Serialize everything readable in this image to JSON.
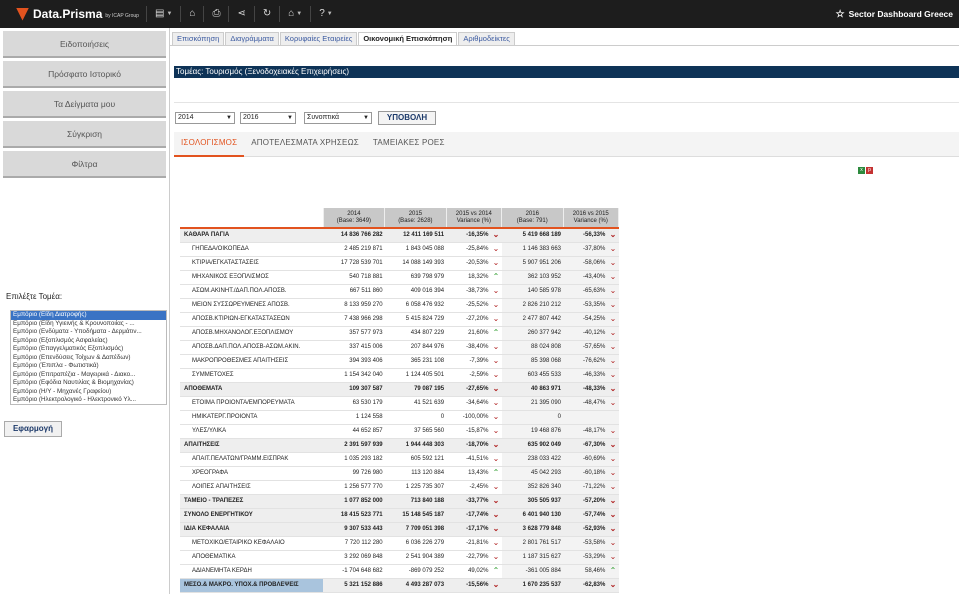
{
  "app": {
    "name": "Data.Prisma",
    "by": "by ICAP Group",
    "dashboard_title": "Sector Dashboard Greece"
  },
  "toolbar": {
    "icons": [
      "document-icon",
      "folder-icon",
      "print-icon",
      "share-icon",
      "refresh-icon",
      "home-icon",
      "help-icon"
    ]
  },
  "sidebar": {
    "items": [
      {
        "label": "Ειδοποιήσεις"
      },
      {
        "label": "Πρόσφατο Ιστορικό"
      },
      {
        "label": "Τα Δείγματα μου"
      },
      {
        "label": "Σύγκριση"
      },
      {
        "label": "Φίλτρα"
      }
    ],
    "sector_label": "Επιλέξτε Τομέα:",
    "sectors": [
      "Εμπόριο (Είδη Διατροφής)",
      "Εμπόριο (Είδη Υγιεινής & Κρουνοποιίας - ...",
      "Εμπόριο (Ενδύματα - Υποδήματα - Δερμάτιν...",
      "Εμπόριο (Εξοπλισμός Ασφαλείας)",
      "Εμπόριο (Επαγγελματικός Εξοπλισμός)",
      "Εμπόριο (Επενδύσεις Τοίχων & Δαπέδων)",
      "Εμπόριο (Έπιπλα - Φωτιστικά)",
      "Εμπόριο (Επιτραπέζια - Μαγειρικά - Διακο...",
      "Εμπόριο (Εφόδια Ναυτιλίας & Βιομηχανίας)",
      "Εμπόριο (Η/Υ - Μηχανές Γραφείου)",
      "Εμπόριο (Ηλεκτρολογικό - Ηλεκτρονικό Υλ..."
    ],
    "apply_label": "Εφαρμογή"
  },
  "tabs": [
    {
      "label": "Επισκόπηση"
    },
    {
      "label": "Διαγράμματα"
    },
    {
      "label": "Κορυφαίες Εταιρείες"
    },
    {
      "label": "Οικονομική Επισκόπηση"
    },
    {
      "label": "Αριθμοδείκτες"
    }
  ],
  "sector_title": "Τομέας: Τουρισμός (Ξενοδοχειακές Επιχειρήσεις)",
  "filters": {
    "year_from": "2014",
    "year_to": "2016",
    "mode": "Συνοπτικά",
    "submit_label": "ΥΠΟΒΟΛΗ"
  },
  "subtabs": [
    {
      "label": "ΙΣΟΛΟΓΙΣΜΟΣ"
    },
    {
      "label": "ΑΠΟΤΕΛΕΣΜΑΤΑ ΧΡΗΣΕΩΣ"
    },
    {
      "label": "ΤΑΜΕΙΑΚΕΣ ΡΟΕΣ"
    }
  ],
  "table": {
    "headers": [
      {
        "line1": "2014",
        "line2": "(Base: 3649)"
      },
      {
        "line1": "2015",
        "line2": "(Base: 2628)"
      },
      {
        "line1": "2015 vs 2014",
        "line2": "Variance (%)"
      },
      {
        "line1": "2016",
        "line2": "(Base: 791)"
      },
      {
        "line1": "2016 vs 2015",
        "line2": "Variance (%)"
      }
    ],
    "rows": [
      {
        "type": "main",
        "label": "ΚΑΘΑΡΑ ΠΑΓΙΑ",
        "v2014": "14 836 766 282",
        "v2015": "12 411 169 511",
        "p1": "-16,35%",
        "a1": "down",
        "v2016": "5 419 668 189",
        "p2": "-56,33%",
        "a2": "down"
      },
      {
        "type": "sub",
        "label": "ΓΗΠΕΔΑ/ΟΙΚΟΠΕΔΑ",
        "v2014": "2 485 219 871",
        "v2015": "1 843 045 088",
        "p1": "-25,84%",
        "a1": "down",
        "v2016": "1 146 383 663",
        "p2": "-37,80%",
        "a2": "down"
      },
      {
        "type": "sub",
        "label": "ΚΤΙΡΙΑ/ΕΓΚΑΤΑΣΤΑΣΕΙΣ",
        "v2014": "17 728 539 701",
        "v2015": "14 088 149 393",
        "p1": "-20,53%",
        "a1": "down",
        "v2016": "5 907 951 206",
        "p2": "-58,06%",
        "a2": "down"
      },
      {
        "type": "sub",
        "label": "ΜΗΧΑΝΙΚΟΣ ΕΞΟΠΛΙΣΜΟΣ",
        "v2014": "540 718 881",
        "v2015": "639 798 979",
        "p1": "18,32%",
        "a1": "up",
        "v2016": "362 103 952",
        "p2": "-43,40%",
        "a2": "down"
      },
      {
        "type": "sub",
        "label": "ΑΣΩΜ.ΑΚΙΝΗΤ./ΔΑΠ.ΠΟΛ.ΑΠΟΣΒ.",
        "v2014": "667 511 860",
        "v2015": "409 016 394",
        "p1": "-38,73%",
        "a1": "down",
        "v2016": "140 585 978",
        "p2": "-65,63%",
        "a2": "down"
      },
      {
        "type": "sub",
        "label": "ΜΕΙΟΝ ΣΥΣΣΩΡΕΥΜΕΝΕΣ ΑΠΟΣΒ.",
        "v2014": "8 133 959 270",
        "v2015": "6 058 476 932",
        "p1": "-25,52%",
        "a1": "down",
        "v2016": "2 826 210 212",
        "p2": "-53,35%",
        "a2": "down"
      },
      {
        "type": "sub",
        "label": "ΑΠΟΣΒ.ΚΤΙΡΙΩΝ-ΕΓΚΑΤΑΣΤΑΣΕΩΝ",
        "v2014": "7 438 966 298",
        "v2015": "5 415 824 729",
        "p1": "-27,20%",
        "a1": "down",
        "v2016": "2 477 807 442",
        "p2": "-54,25%",
        "a2": "down"
      },
      {
        "type": "sub",
        "label": "ΑΠΟΣΒ.ΜΗΧΑΝΟΛΟΓ.ΕΞΟΠΛΙΣΜΟΥ",
        "v2014": "357 577 973",
        "v2015": "434 807 229",
        "p1": "21,60%",
        "a1": "up",
        "v2016": "260 377 942",
        "p2": "-40,12%",
        "a2": "down"
      },
      {
        "type": "sub",
        "label": "ΑΠΟΣΒ.ΔΑΠ.ΠΟΛ.ΑΠΟΣΒ-ΑΣΩΜ.ΑΚΙΝ.",
        "v2014": "337 415 006",
        "v2015": "207 844 976",
        "p1": "-38,40%",
        "a1": "down",
        "v2016": "88 024 808",
        "p2": "-57,65%",
        "a2": "down"
      },
      {
        "type": "sub",
        "label": "ΜΑΚΡΟΠΡΟΘΕΣΜΕΣ ΑΠΑΙΤΗΣΕΙΣ",
        "v2014": "394 393 406",
        "v2015": "365 231 108",
        "p1": "-7,39%",
        "a1": "down",
        "v2016": "85 398 068",
        "p2": "-76,62%",
        "a2": "down"
      },
      {
        "type": "sub",
        "label": "ΣΥΜΜΕΤΟΧΕΣ",
        "v2014": "1 154 342 040",
        "v2015": "1 124 405 501",
        "p1": "-2,59%",
        "a1": "down",
        "v2016": "603 455 533",
        "p2": "-46,33%",
        "a2": "down"
      },
      {
        "type": "main",
        "label": "ΑΠΟΘΕΜΑΤΑ",
        "v2014": "109 307 587",
        "v2015": "79 087 195",
        "p1": "-27,65%",
        "a1": "down",
        "v2016": "40 863 971",
        "p2": "-48,33%",
        "a2": "down"
      },
      {
        "type": "sub",
        "label": "ΕΤΟΙΜΑ ΠΡΟΙΟΝΤΑ/ΕΜΠΟΡΕΥΜΑΤΑ",
        "v2014": "63 530 179",
        "v2015": "41 521 639",
        "p1": "-34,64%",
        "a1": "down",
        "v2016": "21 395 090",
        "p2": "-48,47%",
        "a2": "down"
      },
      {
        "type": "sub",
        "label": "ΗΜΙΚΑΤΕΡΓ.ΠΡΟΙΟΝΤΑ",
        "v2014": "1 124 558",
        "v2015": "0",
        "p1": "-100,00%",
        "a1": "down",
        "v2016": "0",
        "p2": "",
        "a2": ""
      },
      {
        "type": "sub",
        "label": "ΥΛΕΣ/ΥΛΙΚΑ",
        "v2014": "44 652 857",
        "v2015": "37 565 560",
        "p1": "-15,87%",
        "a1": "down",
        "v2016": "19 468 876",
        "p2": "-48,17%",
        "a2": "down"
      },
      {
        "type": "main",
        "label": "ΑΠΑΙΤΗΣΕΙΣ",
        "v2014": "2 391 597 939",
        "v2015": "1 944 448 303",
        "p1": "-18,70%",
        "a1": "down",
        "v2016": "635 902 049",
        "p2": "-67,30%",
        "a2": "down"
      },
      {
        "type": "sub",
        "label": "ΑΠΑΙΤ.ΠΕΛΑΤΩΝ/ΓΡΑΜΜ.ΕΙΣΠΡΑΚ",
        "v2014": "1 035 293 182",
        "v2015": "605 592 121",
        "p1": "-41,51%",
        "a1": "down",
        "v2016": "238 033 422",
        "p2": "-60,69%",
        "a2": "down"
      },
      {
        "type": "sub",
        "label": "ΧΡΕΟΓΡΑΦΑ",
        "v2014": "99 726 980",
        "v2015": "113 120 884",
        "p1": "13,43%",
        "a1": "up",
        "v2016": "45 042 293",
        "p2": "-60,18%",
        "a2": "down"
      },
      {
        "type": "sub",
        "label": "ΛΟΙΠΕΣ ΑΠΑΙΤΗΣΕΙΣ",
        "v2014": "1 256 577 770",
        "v2015": "1 225 735 307",
        "p1": "-2,45%",
        "a1": "down",
        "v2016": "352 826 340",
        "p2": "-71,22%",
        "a2": "down"
      },
      {
        "type": "main",
        "label": "ΤΑΜΕΙΟ - ΤΡΑΠΕΖΕΣ",
        "v2014": "1 077 852 000",
        "v2015": "713 840 188",
        "p1": "-33,77%",
        "a1": "down",
        "v2016": "305 505 937",
        "p2": "-57,20%",
        "a2": "down"
      },
      {
        "type": "main",
        "label": "ΣΥΝΟΛΟ ΕΝΕΡΓΗΤΙΚΟΥ",
        "v2014": "18 415 523 771",
        "v2015": "15 148 545 187",
        "p1": "-17,74%",
        "a1": "down",
        "v2016": "6 401 940 130",
        "p2": "-57,74%",
        "a2": "down"
      },
      {
        "type": "main",
        "label": "ΙΔΙΑ ΚΕΦΑΛΑΙΑ",
        "v2014": "9 307 533 443",
        "v2015": "7 709 051 398",
        "p1": "-17,17%",
        "a1": "down",
        "v2016": "3 628 779 848",
        "p2": "-52,93%",
        "a2": "down"
      },
      {
        "type": "sub",
        "label": "ΜΕΤΟΧΙΚΟ/ΕΤΑΙΡΙΚΟ ΚΕΦΑΛΑΙΟ",
        "v2014": "7 720 112 280",
        "v2015": "6 036 226 279",
        "p1": "-21,81%",
        "a1": "down",
        "v2016": "2 801 761 517",
        "p2": "-53,58%",
        "a2": "down"
      },
      {
        "type": "sub",
        "label": "ΑΠΟΘΕΜΑΤΙΚΑ",
        "v2014": "3 292 069 848",
        "v2015": "2 541 904 389",
        "p1": "-22,79%",
        "a1": "down",
        "v2016": "1 187 315 627",
        "p2": "-53,29%",
        "a2": "down"
      },
      {
        "type": "sub",
        "label": "ΑΔΙΑΝΕΜΗΤΑ ΚΕΡΔΗ",
        "v2014": "-1 704 648 682",
        "v2015": "-869 079 252",
        "p1": "49,02%",
        "a1": "up",
        "v2016": "-361 005 884",
        "p2": "58,46%",
        "a2": "up"
      },
      {
        "type": "main hl",
        "label": "ΜΕΣΟ.& ΜΑΚΡΟ. ΥΠΟΧ.& ΠΡΟΒΛΕΨΕΙΣ",
        "v2014": "5 321 152 886",
        "v2015": "4 493 287 073",
        "p1": "-15,56%",
        "a1": "down",
        "v2016": "1 670 235 537",
        "p2": "-62,83%",
        "a2": "down"
      }
    ]
  }
}
